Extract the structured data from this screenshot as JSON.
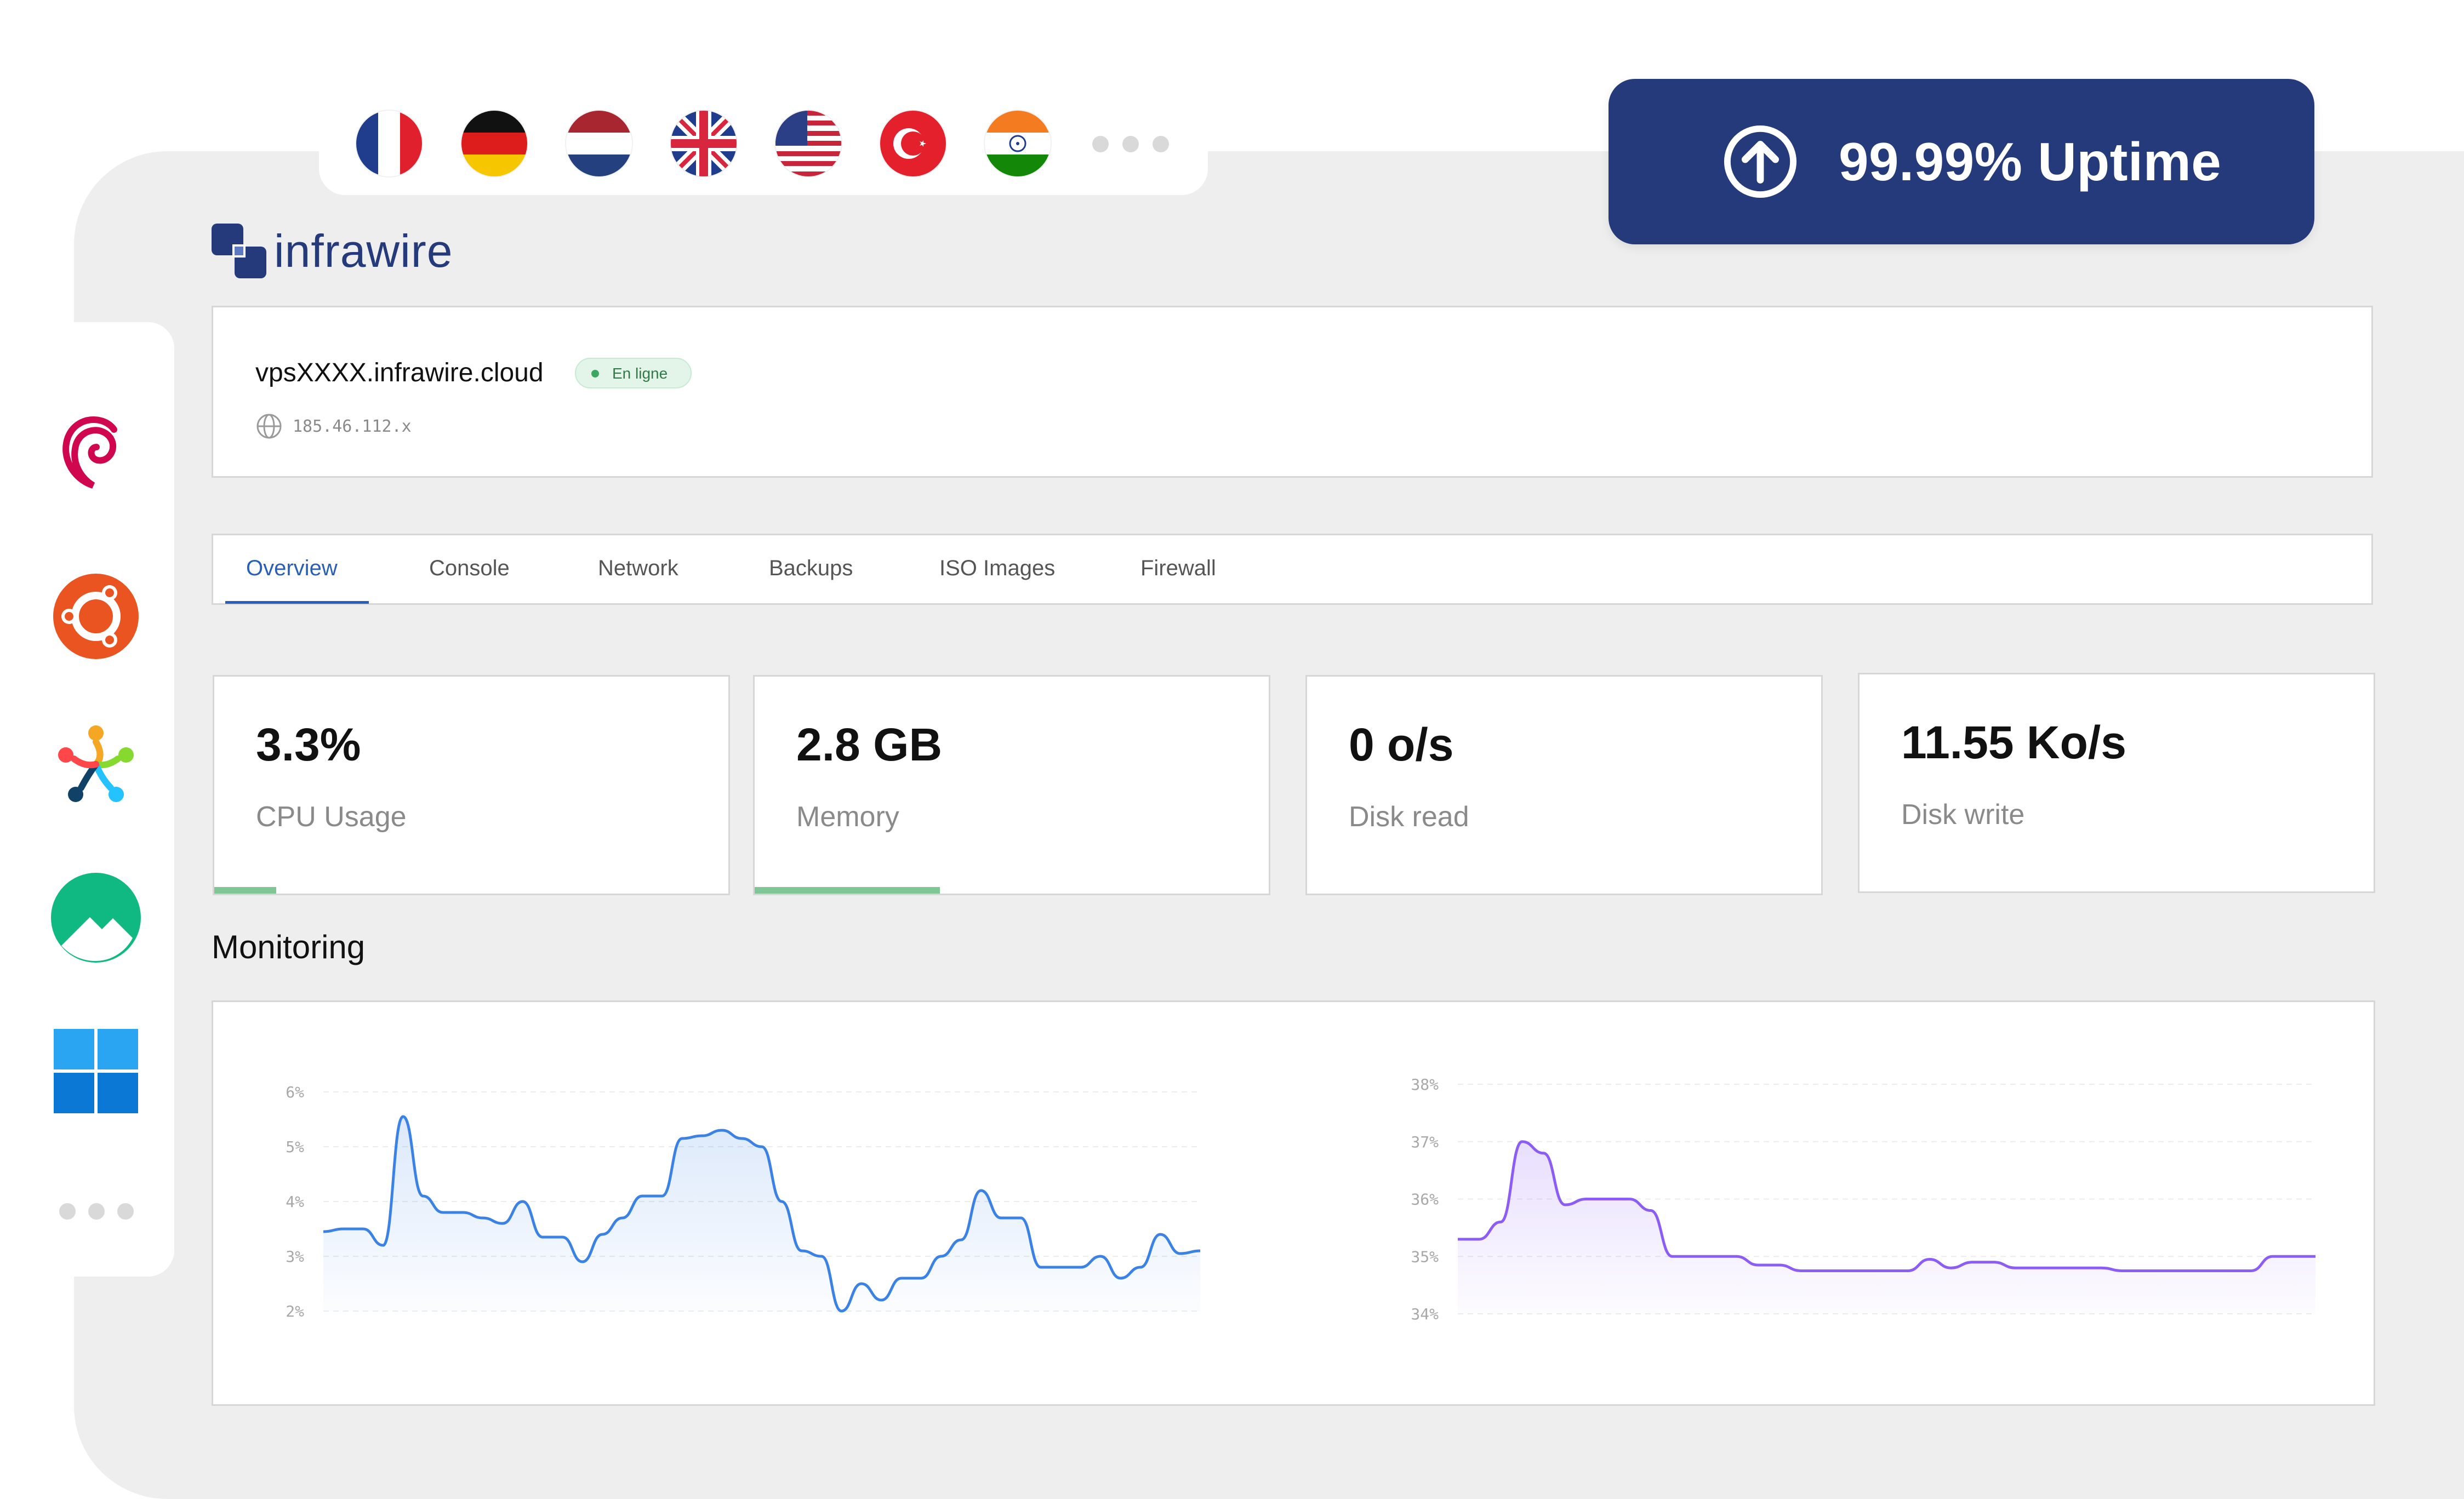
{
  "countries": [
    {
      "name": "france",
      "icon": "france-flag-icon"
    },
    {
      "name": "germany",
      "icon": "germany-flag-icon"
    },
    {
      "name": "netherlands",
      "icon": "netherlands-flag-icon"
    },
    {
      "name": "united-kingdom",
      "icon": "uk-flag-icon"
    },
    {
      "name": "united-states",
      "icon": "usa-flag-icon"
    },
    {
      "name": "turkey",
      "icon": "turkey-flag-icon"
    },
    {
      "name": "india",
      "icon": "india-flag-icon"
    }
  ],
  "uptime": {
    "label": "99.99% Uptime",
    "icon": "arrow-up-circle-icon",
    "color": "#253a7a"
  },
  "brand": {
    "name": "infrawire",
    "color": "#253a7a"
  },
  "os_list": [
    {
      "name": "debian",
      "icon": "debian-icon"
    },
    {
      "name": "ubuntu",
      "icon": "ubuntu-icon"
    },
    {
      "name": "almalinux",
      "icon": "almalinux-icon"
    },
    {
      "name": "rocky-linux",
      "icon": "rocky-linux-icon"
    },
    {
      "name": "windows",
      "icon": "windows-icon"
    }
  ],
  "server": {
    "hostname": "vpsXXXX.infrawire.cloud",
    "status": "En ligne",
    "ip": "185.46.112.x"
  },
  "tabs": [
    {
      "label": "Overview",
      "active": true
    },
    {
      "label": "Console"
    },
    {
      "label": "Network"
    },
    {
      "label": "Backups"
    },
    {
      "label": "ISO Images"
    },
    {
      "label": "Firewall"
    }
  ],
  "stats": [
    {
      "value": "3.3%",
      "label": "CPU Usage",
      "bar_fraction": 0.12
    },
    {
      "value": "2.8 GB",
      "label": "Memory",
      "bar_fraction": 0.36
    },
    {
      "value": "0 o/s",
      "label": "Disk read",
      "bar_fraction": 0
    },
    {
      "value": "11.55 Ko/s",
      "label": "Disk write",
      "bar_fraction": 0
    }
  ],
  "monitoring": {
    "title": "Monitoring"
  },
  "chart_data": [
    {
      "type": "area",
      "yticks": [
        "6%",
        "5%",
        "4%",
        "3%",
        "2%"
      ],
      "ylim": [
        2,
        6
      ],
      "grid": true,
      "color": "#3b82e6",
      "values": [
        3.45,
        3.5,
        3.5,
        3.2,
        5.55,
        4.1,
        3.8,
        3.8,
        3.7,
        3.6,
        4.0,
        3.35,
        3.35,
        2.9,
        3.4,
        3.7,
        4.1,
        4.1,
        5.15,
        5.2,
        5.3,
        5.15,
        5.0,
        4.0,
        3.1,
        3.0,
        2.0,
        2.5,
        2.2,
        2.6,
        2.6,
        3.0,
        3.3,
        4.2,
        3.7,
        3.7,
        2.8,
        2.8,
        2.8,
        3.0,
        2.6,
        2.8,
        3.4,
        3.05,
        3.1
      ]
    },
    {
      "type": "area",
      "yticks": [
        "38%",
        "37%",
        "36%",
        "35%",
        "34%"
      ],
      "ylim": [
        34,
        38
      ],
      "grid": true,
      "color": "#8b5cf6",
      "values": [
        35.3,
        35.3,
        35.6,
        37.0,
        36.8,
        35.9,
        36.0,
        36.0,
        36.0,
        35.8,
        35.0,
        35.0,
        35.0,
        35.0,
        34.85,
        34.85,
        34.75,
        34.75,
        34.75,
        34.75,
        34.75,
        34.75,
        34.95,
        34.8,
        34.9,
        34.9,
        34.8,
        34.8,
        34.8,
        34.8,
        34.8,
        34.75,
        34.75,
        34.75,
        34.75,
        34.75,
        34.75,
        34.75,
        35.0,
        35.0,
        35.0
      ]
    }
  ]
}
